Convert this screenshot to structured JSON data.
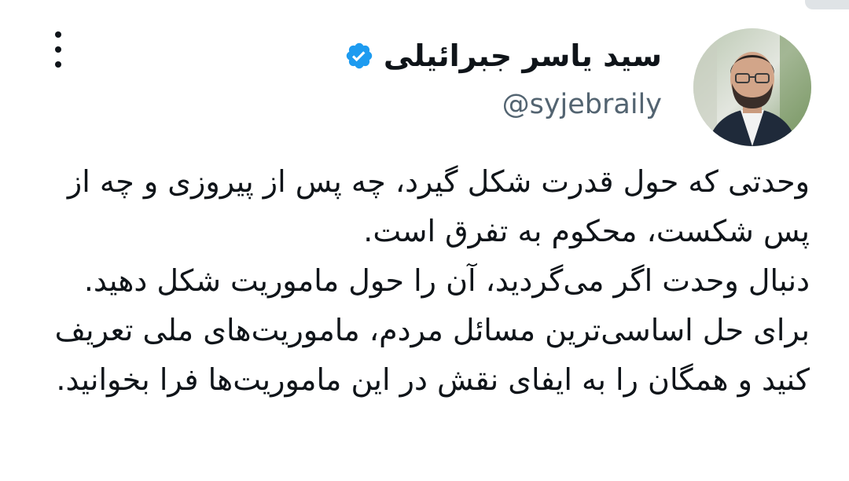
{
  "tweet": {
    "author": {
      "display_name": "سید یاسر جبرائیلی",
      "handle": "@syjebraily",
      "verified": true,
      "avatar_icon": "profile-photo"
    },
    "menu_icon": "more-vertical-icon",
    "paragraphs": [
      "وحدتی که حول قدرت شکل گیرد، چه پس از پیروزی و چه از پس شکست، محکوم به تفرق است.",
      "دنبال وحدت اگر می‌گردید، آن را حول ماموریت شکل دهید. برای حل اساسی‌ترین مسائل مردم، ماموریت‌های ملی تعریف کنید و همگان را به ایفای نقش در این ماموریت‌ها فرا بخوانید."
    ]
  },
  "colors": {
    "text": "#0f1419",
    "secondary_text": "#536471",
    "verified_badge": "#1d9bf0",
    "background": "#ffffff"
  }
}
